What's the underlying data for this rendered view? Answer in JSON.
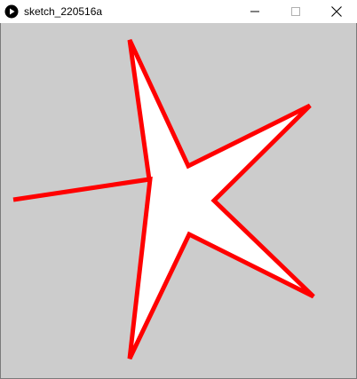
{
  "window": {
    "title": "sketch_220516a",
    "controls": {
      "minimize_icon": "minimize-icon",
      "maximize_icon": "maximize-icon",
      "close_icon": "close-icon"
    },
    "app_icon": "play-icon"
  },
  "canvas": {
    "background": "#cccccc",
    "shape": {
      "type": "star",
      "points": 5,
      "fill": "#ffffff",
      "stroke": "#ff0000"
    }
  }
}
